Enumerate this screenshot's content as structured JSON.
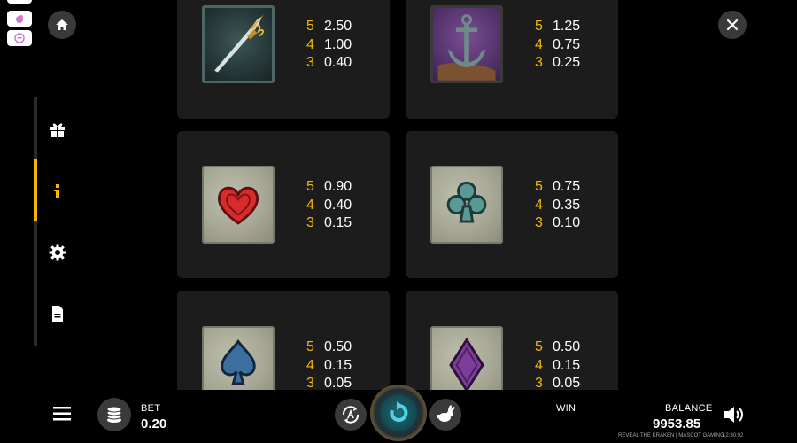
{
  "paytable": [
    {
      "symbol": "sword-icon",
      "payouts": [
        {
          "count": "5",
          "value": "2.50"
        },
        {
          "count": "4",
          "value": "1.00"
        },
        {
          "count": "3",
          "value": "0.40"
        }
      ]
    },
    {
      "symbol": "anchor-icon",
      "payouts": [
        {
          "count": "5",
          "value": "1.25"
        },
        {
          "count": "4",
          "value": "0.75"
        },
        {
          "count": "3",
          "value": "0.25"
        }
      ]
    },
    {
      "symbol": "heart-icon",
      "payouts": [
        {
          "count": "5",
          "value": "0.90"
        },
        {
          "count": "4",
          "value": "0.40"
        },
        {
          "count": "3",
          "value": "0.15"
        }
      ]
    },
    {
      "symbol": "club-icon",
      "payouts": [
        {
          "count": "5",
          "value": "0.75"
        },
        {
          "count": "4",
          "value": "0.35"
        },
        {
          "count": "3",
          "value": "0.10"
        }
      ]
    },
    {
      "symbol": "spade-icon",
      "payouts": [
        {
          "count": "5",
          "value": "0.50"
        },
        {
          "count": "4",
          "value": "0.15"
        },
        {
          "count": "3",
          "value": "0.05"
        }
      ]
    },
    {
      "symbol": "diamond-icon",
      "payouts": [
        {
          "count": "5",
          "value": "0.50"
        },
        {
          "count": "4",
          "value": "0.15"
        },
        {
          "count": "3",
          "value": "0.05"
        }
      ]
    }
  ],
  "bottom": {
    "bet_label": "BET",
    "bet_value": "0.20",
    "win_label": "WIN",
    "balance_label": "BALANCE",
    "balance_value": "9953.85",
    "footer_game": "REVEAL THE KRAKEN | MASCOT GAMING",
    "clock": "12:30:02"
  },
  "sidebar": {
    "items": [
      "gift-icon",
      "info-icon",
      "settings-icon",
      "document-icon"
    ],
    "active_index": 1
  },
  "colors": {
    "accent": "#f5b800",
    "card_bg": "#1c1c1c",
    "button_bg": "#3a3a3a"
  }
}
